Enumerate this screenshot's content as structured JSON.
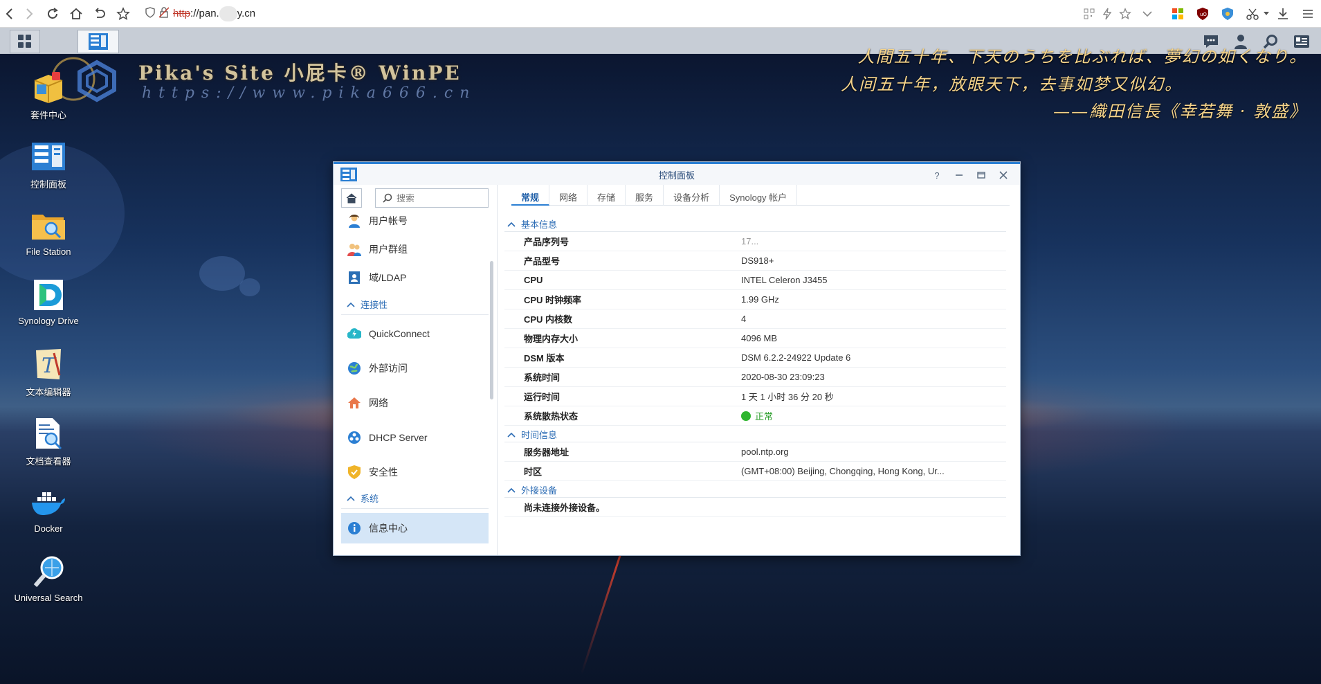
{
  "browser": {
    "url_scheme": "http",
    "url_prefix": "://pan.",
    "url_suffix": "y.cn"
  },
  "desktop": {
    "icons": [
      {
        "label": "套件中心",
        "icon": "package-center-icon"
      },
      {
        "label": "控制面板",
        "icon": "control-panel-icon"
      },
      {
        "label": "File Station",
        "icon": "folder-icon"
      },
      {
        "label": "Synology Drive",
        "icon": "synology-drive-icon"
      },
      {
        "label": "文本编辑器",
        "icon": "text-editor-icon"
      },
      {
        "label": "文档查看器",
        "icon": "document-viewer-icon"
      },
      {
        "label": "Docker",
        "icon": "docker-icon"
      },
      {
        "label": "Universal Search",
        "icon": "universal-search-icon"
      }
    ],
    "logo": {
      "title": "Pika's Site 小屁卡® WinPE",
      "url": "https://www.pika666.cn"
    },
    "poem": {
      "line1": "人間五十年、下天のうちを比ぶれば、夢幻の如くなり。",
      "line2": "人间五十年，放眼天下，去事如梦又似幻。",
      "line3": "——織田信長《幸若舞 · 敦盛》"
    }
  },
  "window": {
    "title": "控制面板",
    "search_placeholder": "搜索",
    "sidebar": {
      "items": [
        {
          "label": "用户帐号",
          "icon": "user-icon"
        },
        {
          "label": "用户群组",
          "icon": "user-group-icon"
        },
        {
          "label": "域/LDAP",
          "icon": "domain-ldap-icon"
        },
        {
          "section": "连接性"
        },
        {
          "label": "QuickConnect",
          "icon": "quickconnect-icon"
        },
        {
          "label": "外部访问",
          "icon": "external-access-icon"
        },
        {
          "label": "网络",
          "icon": "network-icon"
        },
        {
          "label": "DHCP Server",
          "icon": "dhcp-server-icon"
        },
        {
          "label": "安全性",
          "icon": "security-shield-icon"
        },
        {
          "section": "系统"
        },
        {
          "label": "信息中心",
          "icon": "info-center-icon",
          "active": true
        }
      ]
    },
    "tabs": [
      "常规",
      "网络",
      "存储",
      "服务",
      "设备分析",
      "Synology 帐户"
    ],
    "active_tab": "常规",
    "sections": [
      {
        "title": "基本信息",
        "rows": [
          {
            "k": "产品序列号",
            "v": "17..."
          },
          {
            "k": "产品型号",
            "v": "DS918+"
          },
          {
            "k": "CPU",
            "v": "INTEL Celeron J3455"
          },
          {
            "k": "CPU 时钟频率",
            "v": "1.99 GHz"
          },
          {
            "k": "CPU 内核数",
            "v": "4"
          },
          {
            "k": "物理内存大小",
            "v": "4096 MB"
          },
          {
            "k": "DSM 版本",
            "v": "DSM 6.2.2-24922 Update 6"
          },
          {
            "k": "系统时间",
            "v": "2020-08-30 23:09:23"
          },
          {
            "k": "运行时间",
            "v": "1 天 1 小时 36 分 20 秒"
          },
          {
            "k": "系统散热状态",
            "v": "正常",
            "status": "ok"
          }
        ]
      },
      {
        "title": "时间信息",
        "rows": [
          {
            "k": "服务器地址",
            "v": "pool.ntp.org"
          },
          {
            "k": "时区",
            "v": "(GMT+08:00) Beijing, Chongqing, Hong Kong, Ur..."
          }
        ]
      },
      {
        "title": "外接设备",
        "rows": [
          {
            "k": "尚未连接外接设备。",
            "v": ""
          }
        ]
      }
    ],
    "colors": {
      "accent": "#2b7fd3",
      "status_ok": "#2fb52f"
    }
  }
}
